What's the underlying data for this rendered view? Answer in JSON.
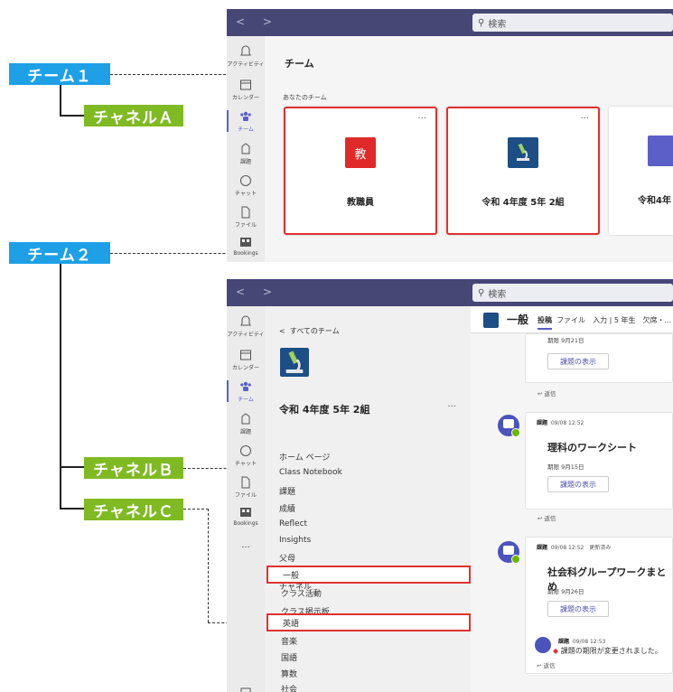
{
  "labels": {
    "team1": "チーム１",
    "team2": "チーム２",
    "channelA": "チャネルＡ",
    "channelB": "チャネルＢ",
    "channelC": "チャネルＣ"
  },
  "colors": {
    "team_label": "#1ea0e6",
    "channel_label": "#7fba23",
    "highlight": "#e0312f",
    "teams_purple": "#464775"
  },
  "search": {
    "placeholder": "検索"
  },
  "rail": {
    "activity": "アクティビティ",
    "calendar": "カレンダー",
    "teams": "チーム",
    "assignments": "課題",
    "chat": "チャット",
    "files": "ファイル",
    "bookings": "Bookings",
    "more": "···"
  },
  "teams_view": {
    "title": "チーム",
    "section": "あなたのチーム",
    "cards": [
      {
        "tile_text": "教",
        "name": "教職員",
        "more": "···"
      },
      {
        "tile_text": "",
        "name": "令和 4年度 5年 2組",
        "more": "···"
      },
      {
        "tile_text": "",
        "name": "令和4年"
      }
    ]
  },
  "channel_view": {
    "back": "すべてのチーム",
    "team_name": "令和 4年度 5年 2組",
    "team_more": "···",
    "links": [
      "ホーム ページ",
      "Class Notebook",
      "課題",
      "成績",
      "Reflect",
      "Insights",
      "父母"
    ],
    "channels_header": "チャネル",
    "channels": [
      "一般",
      "クラス活動",
      "クラス掲示板",
      "英語",
      "音楽",
      "国語",
      "算数",
      "社会"
    ],
    "current_channel": "一般",
    "tabs": "ファイル　入力 | 5 年生　欠席・...",
    "active_tab": "投稿",
    "posts": [
      {
        "meta_kind": "",
        "meta_time": "",
        "title": "",
        "due": "期限 9月21日",
        "button": "課題の表示",
        "reply": "返信"
      },
      {
        "meta_kind": "課題",
        "meta_time": "09/08 12:52",
        "title": "理科のワークシート",
        "due": "期限 9月15日",
        "button": "課題の表示",
        "reply": "返信"
      },
      {
        "meta_kind": "課題",
        "meta_time": "09/08 12:52　更新済み",
        "title": "社会科グループワークまとめ",
        "due": "期限 9月26日",
        "button": "課題の表示",
        "reply": "返信"
      }
    ],
    "notice": {
      "meta_kind": "課題",
      "meta_time": "09/08 12:53",
      "text": "課題の期限が変更されました。"
    }
  }
}
